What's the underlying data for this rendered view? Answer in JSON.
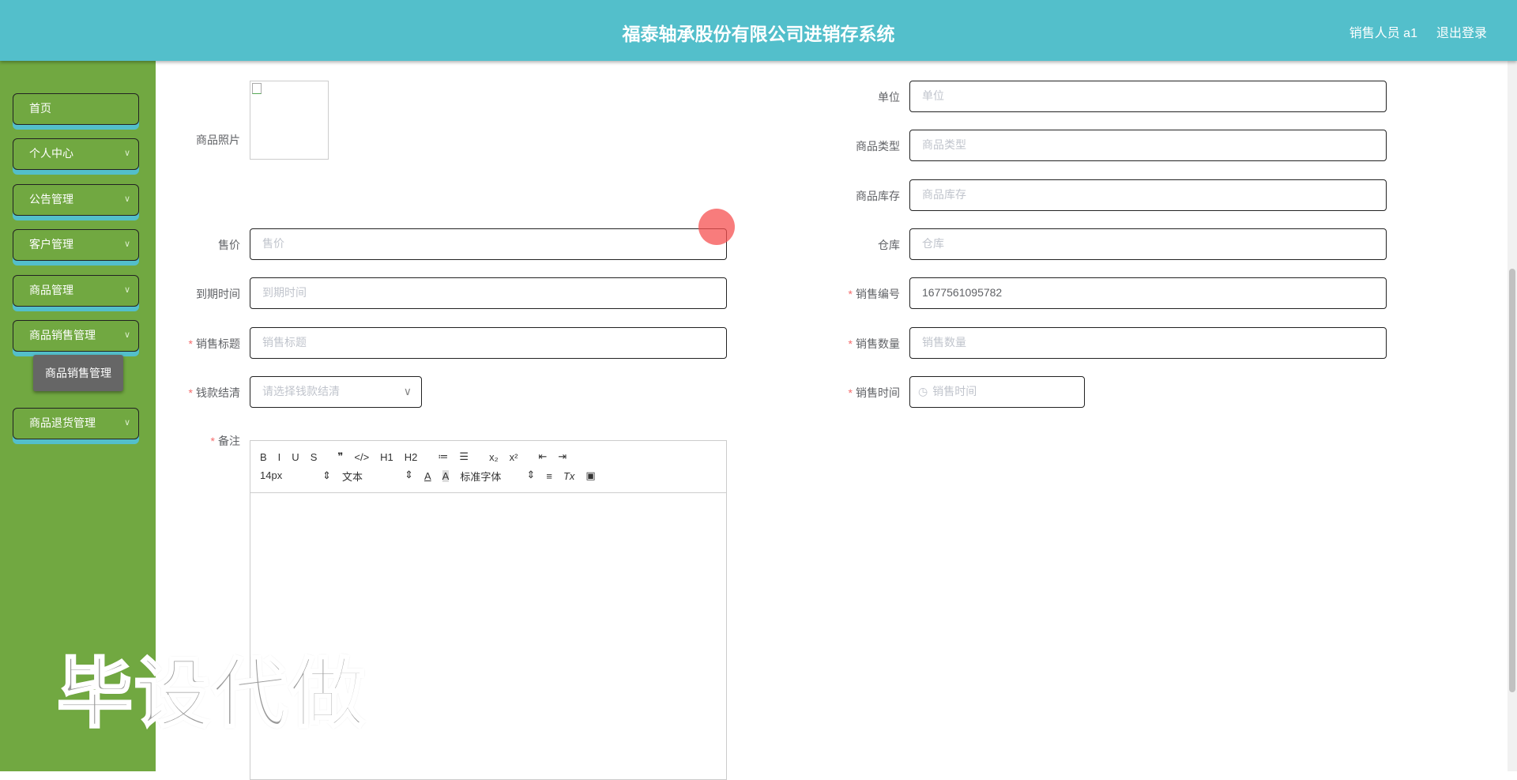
{
  "header": {
    "title": "福泰轴承股份有限公司进销存系统",
    "user": "销售人员 a1",
    "logout": "退出登录"
  },
  "sidebar": {
    "items": [
      {
        "label": "首页",
        "chev": ""
      },
      {
        "label": "个人中心",
        "chev": "∨"
      },
      {
        "label": "公告管理",
        "chev": "∨"
      },
      {
        "label": "客户管理",
        "chev": "∨"
      },
      {
        "label": "商品管理",
        "chev": "∨"
      },
      {
        "label": "商品销售管理",
        "chev": "∨"
      },
      {
        "label": "商品退货管理",
        "chev": "∨"
      }
    ],
    "sub": "商品销售管理"
  },
  "form": {
    "photo_label": "商品照片",
    "left": [
      {
        "label": "售价",
        "placeholder": "售价",
        "req": ""
      },
      {
        "label": "到期时间",
        "placeholder": "到期时间",
        "req": ""
      },
      {
        "label": "销售标题",
        "placeholder": "销售标题",
        "req": "*"
      },
      {
        "label": "钱款结清",
        "placeholder": "请选择钱款结清",
        "req": "*"
      }
    ],
    "right": [
      {
        "label": "单位",
        "placeholder": "单位",
        "req": ""
      },
      {
        "label": "商品类型",
        "placeholder": "商品类型",
        "req": ""
      },
      {
        "label": "商品库存",
        "placeholder": "商品库存",
        "req": ""
      },
      {
        "label": "仓库",
        "placeholder": "仓库",
        "req": ""
      },
      {
        "label": "销售编号",
        "value": "1677561095782",
        "req": "*"
      },
      {
        "label": "销售数量",
        "placeholder": "销售数量",
        "req": "*"
      },
      {
        "label": "销售时间",
        "placeholder": "销售时间",
        "req": "*"
      }
    ],
    "note_label": "备注",
    "editor": {
      "row1": [
        "B",
        "I",
        "U",
        "S",
        "❞",
        "</>",
        "H1",
        "H2",
        "≔",
        "☰",
        "x₂",
        "x²",
        "⇤",
        "⇥"
      ],
      "size": "14px",
      "header": "文本",
      "font": "标准字体",
      "row2": [
        "A",
        "A",
        "≡",
        "Tx",
        "▣"
      ]
    }
  },
  "watermark": "毕设代做"
}
